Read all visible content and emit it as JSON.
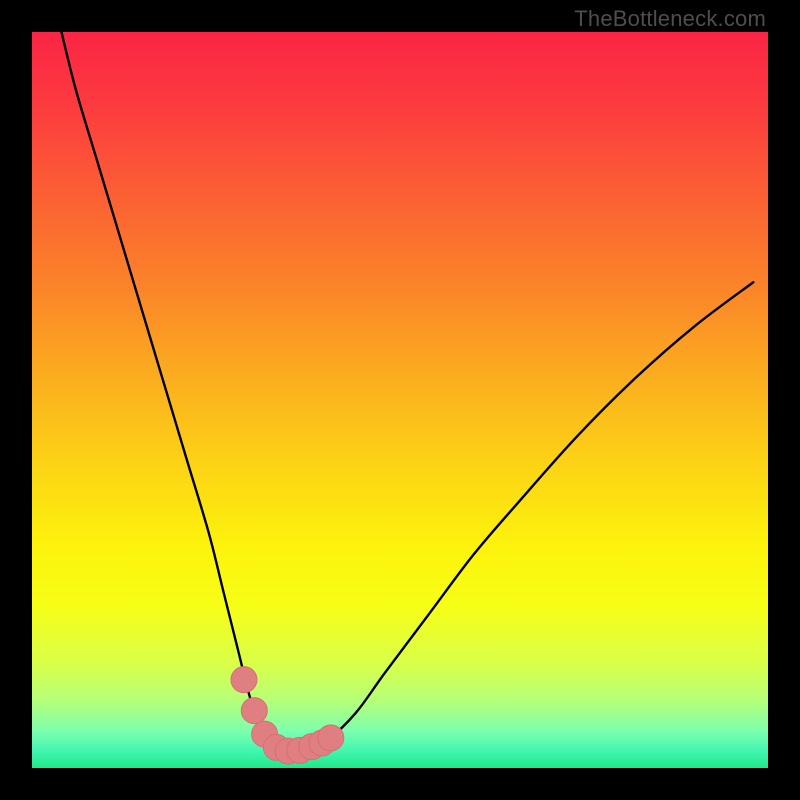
{
  "watermark": "TheBottleneck.com",
  "colors": {
    "frame": "#000000",
    "curve": "#000000",
    "marker_fill": "#e07f82",
    "marker_stroke": "#d86e74",
    "gradient_stops": [
      {
        "offset": 0.0,
        "color": "#fb2545"
      },
      {
        "offset": 0.1,
        "color": "#fc3b3f"
      },
      {
        "offset": 0.22,
        "color": "#fb5f34"
      },
      {
        "offset": 0.35,
        "color": "#fb8529"
      },
      {
        "offset": 0.48,
        "color": "#fbb11e"
      },
      {
        "offset": 0.6,
        "color": "#fcd714"
      },
      {
        "offset": 0.7,
        "color": "#fdf30c"
      },
      {
        "offset": 0.78,
        "color": "#f7fe17"
      },
      {
        "offset": 0.86,
        "color": "#d8ff4a"
      },
      {
        "offset": 0.91,
        "color": "#b4ff7b"
      },
      {
        "offset": 0.95,
        "color": "#7cffae"
      },
      {
        "offset": 0.975,
        "color": "#45f7b0"
      },
      {
        "offset": 1.0,
        "color": "#1fe989"
      }
    ]
  },
  "chart_data": {
    "type": "line",
    "title": "",
    "xlabel": "",
    "ylabel": "",
    "xlim": [
      0,
      100
    ],
    "ylim": [
      0,
      100
    ],
    "series": [
      {
        "name": "bottleneck-curve",
        "x": [
          4,
          6,
          9,
          12,
          15,
          18,
          21,
          24,
          26,
          28,
          29.5,
          31,
          32.5,
          34,
          36,
          38,
          40,
          44,
          48,
          54,
          60,
          66,
          74,
          82,
          90,
          98
        ],
        "y": [
          100,
          92,
          82,
          72,
          62,
          52,
          42,
          32,
          24,
          16,
          10,
          5.5,
          3.2,
          2.4,
          2.3,
          2.6,
          3.6,
          7.5,
          13,
          21,
          29,
          36,
          45,
          53,
          60,
          66
        ]
      }
    ],
    "markers": {
      "name": "highlight-points",
      "x": [
        28.8,
        30.2,
        31.6,
        33.2,
        34.8,
        36.4,
        38.0,
        39.4,
        40.6
      ],
      "y": [
        12.0,
        7.8,
        4.6,
        2.8,
        2.3,
        2.4,
        2.9,
        3.4,
        4.1
      ],
      "radius_px": 13
    }
  }
}
